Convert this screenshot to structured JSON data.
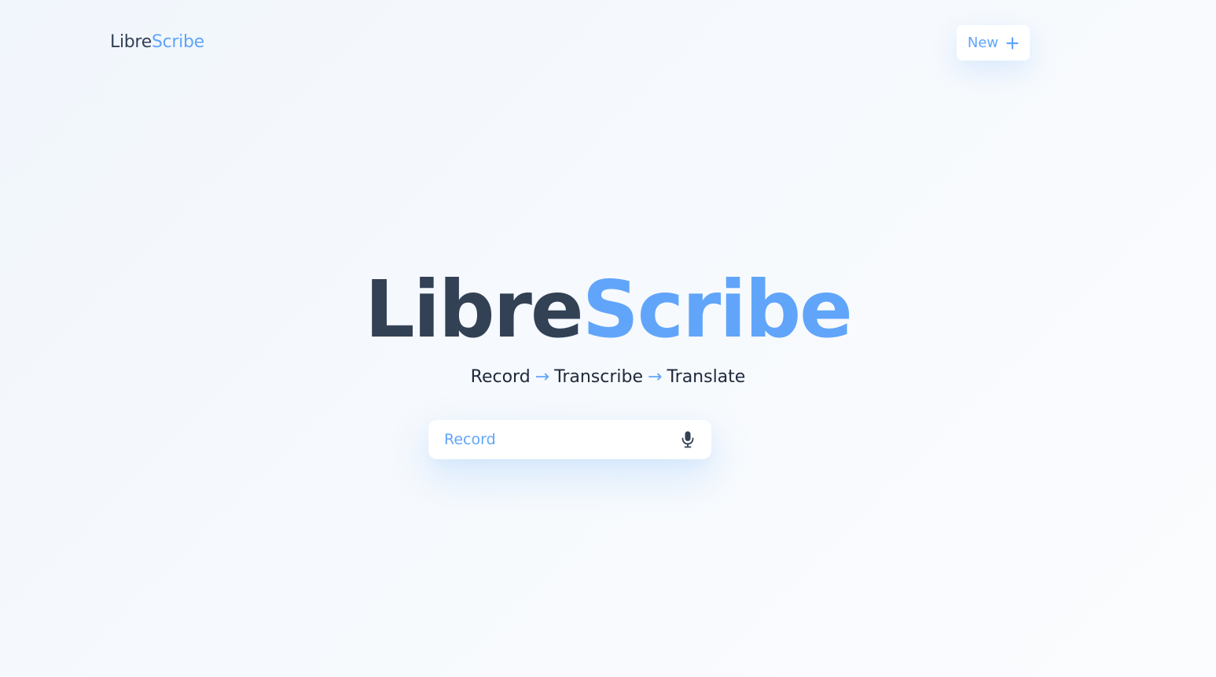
{
  "header": {
    "logo": {
      "part1": "Libre",
      "part2": "Scribe"
    },
    "new_button": {
      "label": "New",
      "icon": "plus-icon"
    }
  },
  "hero": {
    "title": {
      "part1": "Libre",
      "part2": "Scribe"
    },
    "tagline": {
      "steps": [
        "Record",
        "Transcribe",
        "Translate"
      ],
      "separator": "→"
    }
  },
  "record_button": {
    "label": "Record",
    "icon": "microphone-icon"
  },
  "colors": {
    "text_dark": "#334155",
    "accent_blue": "#60a5fa",
    "background": "#f4f8fd",
    "surface": "#ffffff"
  }
}
